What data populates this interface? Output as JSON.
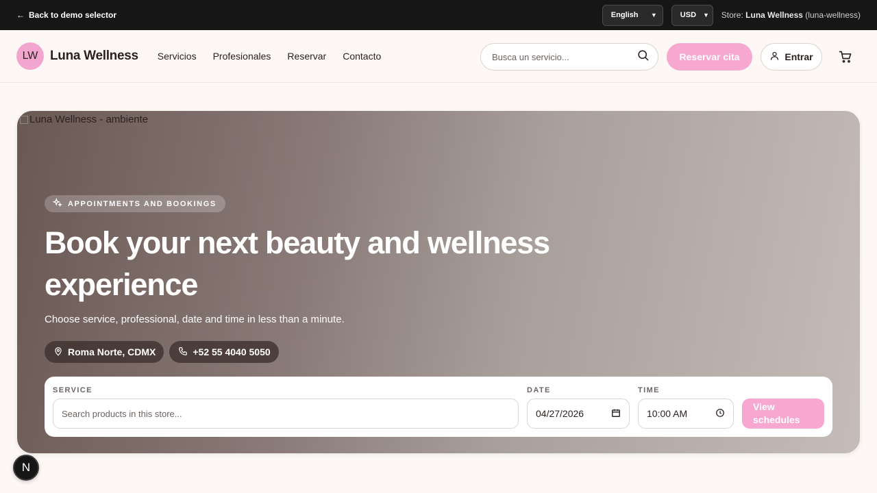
{
  "topbar": {
    "back_label": "Back to demo selector",
    "language": "English",
    "currency": "USD",
    "store_prefix": "Store: ",
    "store_name": "Luna Wellness",
    "store_slug": " (luna-wellness)"
  },
  "header": {
    "logo_initials": "LW",
    "logo_name": "Luna Wellness",
    "nav": [
      "Servicios",
      "Profesionales",
      "Reservar",
      "Contacto"
    ],
    "search_placeholder": "Busca un servicio...",
    "book_button": "Reservar cita",
    "login_button": "Entrar"
  },
  "hero": {
    "image_alt": "Luna Wellness - ambiente",
    "eyebrow": "APPOINTMENTS AND BOOKINGS",
    "title": "Book your next beauty and wellness experience",
    "subtitle": "Choose service, professional, date and time in less than a minute.",
    "location": "Roma Norte, CDMX",
    "phone": "+52 55 4040 5050"
  },
  "booking": {
    "service_label": "SERVICE",
    "service_placeholder": "Search products in this store...",
    "date_label": "DATE",
    "date_value": "04/27/2026",
    "time_label": "TIME",
    "time_value": "10:00 AM",
    "submit_label": "View schedules"
  },
  "dev_badge": "N",
  "colors": {
    "accent_pink": "#f7a8d1",
    "logo_pink": "#f2a6cf",
    "topbar_bg": "#161616",
    "page_bg": "#fdf8f5"
  },
  "icons": [
    "arrow-left-icon",
    "chevron-down-icon",
    "search-icon",
    "user-icon",
    "cart-icon",
    "sparkle-icon",
    "map-pin-icon",
    "phone-icon",
    "calendar-icon",
    "clock-icon"
  ]
}
